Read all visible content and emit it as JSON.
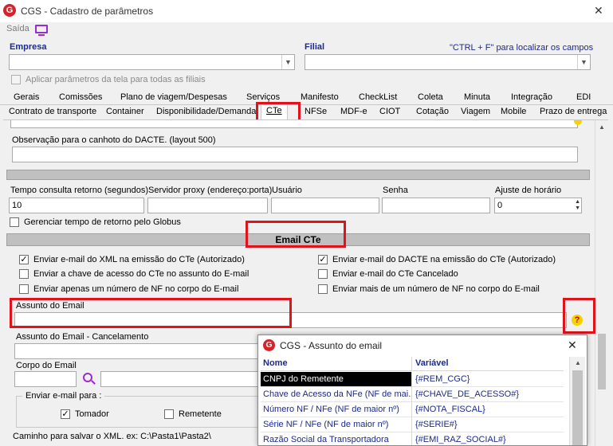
{
  "window": {
    "title": "CGS - Cadastro de parâmetros",
    "close_glyph": "✕"
  },
  "toolbar": {
    "saida_label": "Saída"
  },
  "fields": {
    "empresa_label": "Empresa",
    "filial_label": "Filial",
    "hint": "\"CTRL + F\" para localizar os campos",
    "apply_all_label": "Aplicar parâmetros da tela para todas as filiais"
  },
  "tabs_row1": [
    "Gerais",
    "Comissões",
    "Plano de viagem/Despesas",
    "Serviços",
    "Manifesto",
    "CheckList",
    "Coleta",
    "Minuta",
    "Integração",
    "EDI"
  ],
  "tabs_row2": [
    "Contrato de transporte",
    "Container",
    "Disponibilidade/Demanda",
    "CTe",
    "NFSe",
    "MDF-e",
    "CIOT",
    "Cotação",
    "Viagem",
    "Mobile",
    "Prazo de entrega"
  ],
  "content": {
    "obs_label": "Observação para o canhoto do DACTE. (layout 500)",
    "tempo_label": "Tempo consulta retorno (segundos)",
    "tempo_value": "10",
    "proxy_label": "Servidor proxy (endereço:porta)",
    "usuario_label": "Usuário",
    "senha_label": "Senha",
    "ajuste_label": "Ajuste de horário",
    "ajuste_value": "0",
    "gerenciar_label": "Gerenciar tempo de retorno pelo Globus",
    "email_section": "Email CTe",
    "cb1": "Enviar e-mail do XML na emissão do CTe (Autorizado)",
    "cb2": "Enviar a chave de acesso do CTe no assunto do E-mail",
    "cb3": "Enviar apenas um número de NF no corpo do E-mail",
    "cb4": "Enviar e-mail do DACTE na emissão do CTe (Autorizado)",
    "cb5": "Enviar e-mail do CTe Cancelado",
    "cb6": "Enviar mais de um número de NF no corpo do E-mail",
    "assunto_label": "Assunto do Email",
    "assunto_cancel_label": "Assunto do Email - Cancelamento",
    "corpo_label": "Corpo do Email",
    "enviar_para_label": "Enviar e-mail para :",
    "tomador_label": "Tomador",
    "remetente_label": "Remetente",
    "caminho_label": "Caminho para salvar o XML. ex: C:\\Pasta1\\Pasta2\\",
    "help_glyph": "?"
  },
  "popup": {
    "title": "CGS - Assunto do email",
    "col_nome": "Nome",
    "col_variavel": "Variável",
    "rows": [
      {
        "nome": "CNPJ do Remetente",
        "var": "{#REM_CGC}"
      },
      {
        "nome": "Chave de Acesso da NFe (NF de mai...",
        "var": "{#CHAVE_DE_ACESSO#}"
      },
      {
        "nome": "Número NF / NFe (NF de maior nº)",
        "var": "{#NOTA_FISCAL}"
      },
      {
        "nome": "Série NF / NFe (NF de maior nº)",
        "var": "{#SERIE#}"
      },
      {
        "nome": "Razão Social da Transportadora",
        "var": "{#EMI_RAZ_SOCIAL#}"
      }
    ]
  },
  "colors": {
    "accent": "#e3121a",
    "header_bg": "#c0c0c0",
    "link": "#1b2a8c"
  }
}
